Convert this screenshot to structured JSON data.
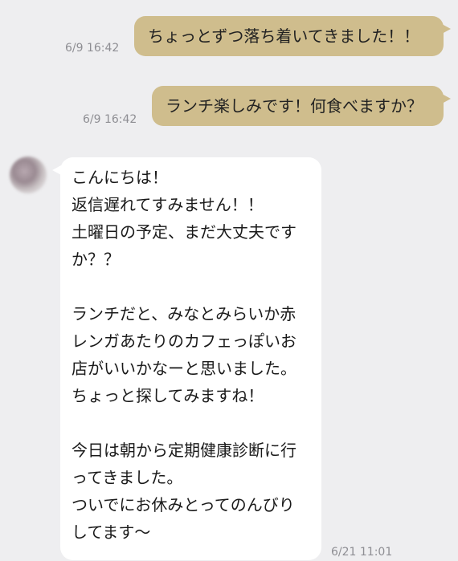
{
  "messages": [
    {
      "side": "sent",
      "text": "ちょっとずつ落ち着いてきました！！",
      "time": "6/9 16:42"
    },
    {
      "side": "sent",
      "text": "ランチ楽しみです！何食べますか？",
      "time": "6/9 16:42"
    },
    {
      "side": "received",
      "lines": [
        "こんにちは！",
        "返信遅れてすみません！！",
        "土曜日の予定、まだ大丈夫です",
        "か？？",
        "",
        "ランチだと、みなとみらいか赤",
        "レンガあたりのカフェっぽいお",
        "店がいいかなーと思いました。",
        "ちょっと探してみますね！",
        "",
        "今日は朝から定期健康診断に行",
        "ってきました。",
        "ついでにお休みとってのんびり",
        "してます〜"
      ],
      "time": "6/21 11:01"
    }
  ],
  "colors": {
    "background": "#eeeef0",
    "sent_bubble": "#cfbd8d",
    "received_bubble": "#ffffff",
    "timestamp": "#8e8e93"
  }
}
